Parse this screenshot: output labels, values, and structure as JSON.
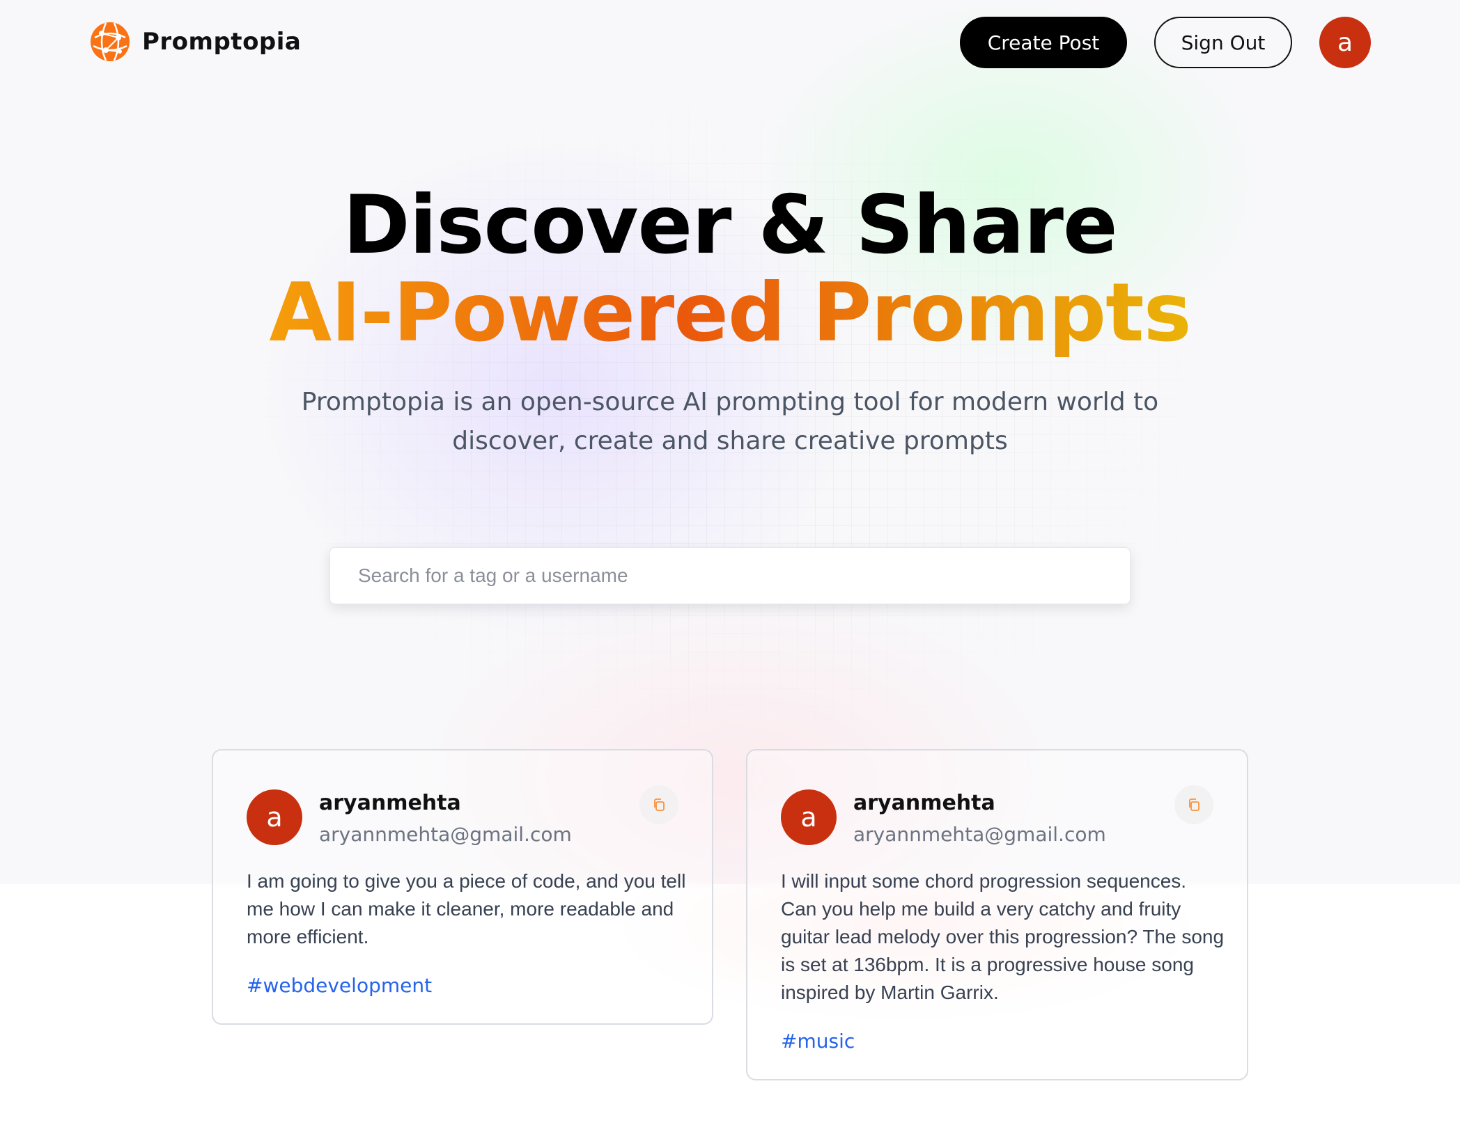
{
  "nav": {
    "brand": "Promptopia",
    "create_post_label": "Create Post",
    "sign_out_label": "Sign Out",
    "avatar_letter": "a"
  },
  "hero": {
    "title_line1": "Discover & Share",
    "title_line2": "AI-Powered Prompts",
    "description": "Promptopia is an open-source AI prompting tool for modern world to discover, create and share creative prompts"
  },
  "search": {
    "placeholder": "Search for a tag or a username",
    "value": ""
  },
  "prompts": [
    {
      "avatar_letter": "a",
      "username": "aryanmehta",
      "email": "aryannmehta@gmail.com",
      "text": "I am going to give you a piece of code, and you tell me how I can make it cleaner, more readable and more efficient.",
      "tag": "#webdevelopment"
    },
    {
      "avatar_letter": "a",
      "username": "aryanmehta",
      "email": "aryannmehta@gmail.com",
      "text": "I will input some chord progression sequences. Can you help me build a very catchy and fruity guitar lead melody over this progression? The song is set at 136bpm. It is a progressive house song inspired by Martin Garrix.",
      "tag": "#music"
    }
  ],
  "icons": {
    "logo": "globe-logo-icon",
    "copy": "copy-icon"
  },
  "colors": {
    "brand_orange": "#f97316",
    "avatar_bg": "#c8300f",
    "tag_blue": "#2563eb",
    "gradient_start": "#f59e0b",
    "gradient_mid": "#ea580c",
    "gradient_end": "#eab308"
  }
}
